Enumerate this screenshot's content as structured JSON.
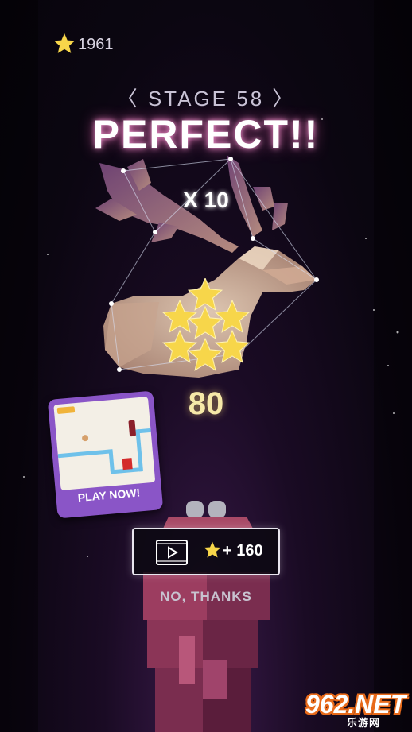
{
  "header": {
    "star_total": "1961"
  },
  "stage": {
    "label": "STAGE 58",
    "prev_arrow": "〈",
    "next_arrow": "〉"
  },
  "result": {
    "title": "PERFECT!!",
    "multiplier": "X 10",
    "stars_earned": 7,
    "score": "80"
  },
  "ad": {
    "cta": "PLAY NOW!"
  },
  "bonus": {
    "label": "+ 160"
  },
  "skip": {
    "label": "NO, THANKS"
  },
  "watermark": {
    "main": "962.NET",
    "sub": "乐游网"
  },
  "colors": {
    "star": "#f7d64a",
    "ad_card": "#8a55c7",
    "title_glow": "#ff9ad9"
  }
}
